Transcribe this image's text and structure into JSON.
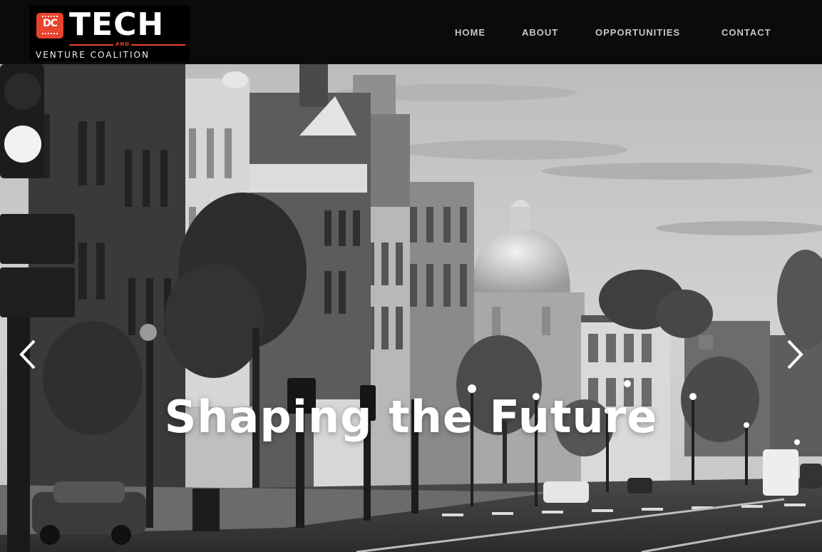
{
  "logo": {
    "badge_text": "DC",
    "main_text": "TECH",
    "and_text": "AND",
    "sub_text": "VENTURE COALITION"
  },
  "nav": {
    "items": [
      {
        "label": "HOME"
      },
      {
        "label": "ABOUT"
      },
      {
        "label": "OPPORTUNITIES"
      },
      {
        "label": "CONTACT"
      }
    ]
  },
  "hero": {
    "headline": "Shaping the Future",
    "prev_icon": "chevron-left-icon",
    "next_icon": "chevron-right-icon"
  },
  "colors": {
    "header_bg": "#0c0a0b",
    "brand_red": "#e8432f",
    "nav_text": "#c9c6c7"
  }
}
